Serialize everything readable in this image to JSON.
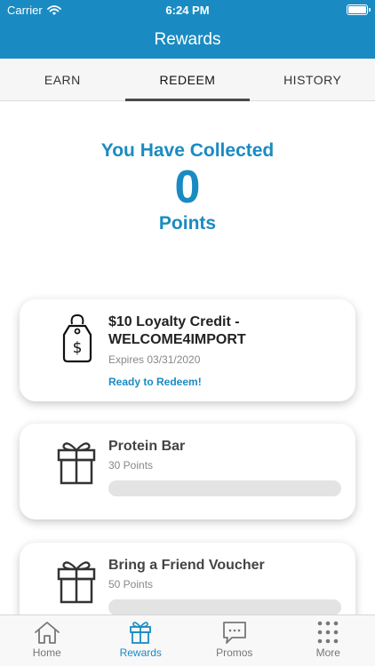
{
  "status_bar": {
    "carrier": "Carrier",
    "time": "6:24 PM"
  },
  "header": {
    "title": "Rewards"
  },
  "tabs": [
    {
      "label": "EARN",
      "active": false
    },
    {
      "label": "REDEEM",
      "active": true
    },
    {
      "label": "HISTORY",
      "active": false
    }
  ],
  "summary": {
    "title": "You Have Collected",
    "points": "0",
    "unit": "Points"
  },
  "rewards": [
    {
      "title": "$10 Loyalty Credit - WELCOME4IMPORT",
      "subtitle": "Expires 03/31/2020",
      "status": "Ready to Redeem!",
      "icon": "price-tag-icon"
    },
    {
      "title": "Protein Bar",
      "subtitle": "30 Points",
      "progress": 0,
      "icon": "gift-icon"
    },
    {
      "title": "Bring a Friend Voucher",
      "subtitle": "50 Points",
      "progress": 0,
      "icon": "gift-icon"
    }
  ],
  "bottom_nav": [
    {
      "label": "Home",
      "icon": "home-icon",
      "active": false
    },
    {
      "label": "Rewards",
      "icon": "gift-icon",
      "active": true
    },
    {
      "label": "Promos",
      "icon": "chat-bubble-icon",
      "active": false
    },
    {
      "label": "More",
      "icon": "grid-dots-icon",
      "active": false
    }
  ],
  "colors": {
    "brand": "#1a8bc2",
    "inactive_nav": "#777777"
  }
}
